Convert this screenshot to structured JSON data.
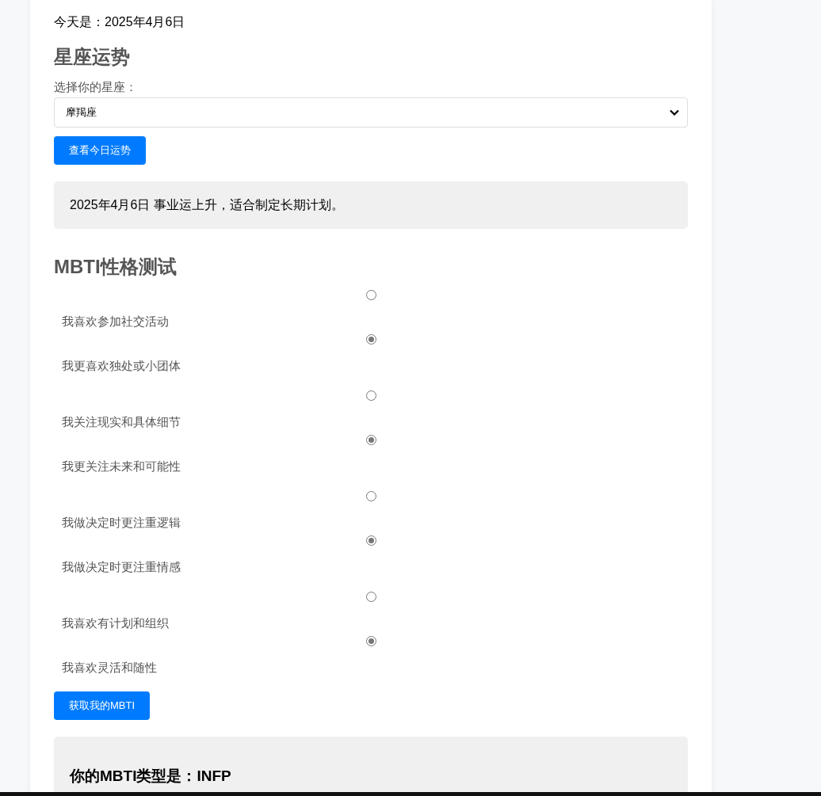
{
  "date_line": "今天是：2025年4月6日",
  "horoscope": {
    "title": "星座运势",
    "label": "选择你的星座：",
    "select_value": "摩羯座",
    "button": "查看今日运势",
    "result": "2025年4月6日 事业运上升，适合制定长期计划。"
  },
  "mbti": {
    "title": "MBTI性格测试",
    "questions": [
      {
        "options": [
          {
            "label": "我喜欢参加社交活动",
            "selected": false
          },
          {
            "label": "我更喜欢独处或小团体",
            "selected": true
          }
        ]
      },
      {
        "options": [
          {
            "label": "我关注现实和具体细节",
            "selected": false
          },
          {
            "label": "我更关注未来和可能性",
            "selected": true
          }
        ]
      },
      {
        "options": [
          {
            "label": "我做决定时更注重逻辑",
            "selected": false
          },
          {
            "label": "我做决定时更注重情感",
            "selected": true
          }
        ]
      },
      {
        "options": [
          {
            "label": "我喜欢有计划和组织",
            "selected": false
          },
          {
            "label": "我喜欢灵活和随性",
            "selected": true
          }
        ]
      }
    ],
    "button": "获取我的MBTI",
    "result_title": "你的MBTI类型是：INFP"
  }
}
